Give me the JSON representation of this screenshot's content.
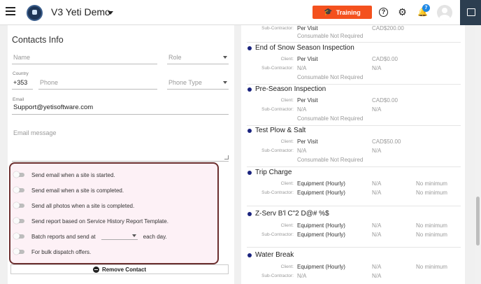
{
  "header": {
    "app_title": "V3 Yeti Demo",
    "training_label": "Training",
    "notification_count": "7"
  },
  "contacts": {
    "section_title": "Contacts Info",
    "name_placeholder": "Name",
    "role_placeholder": "Role",
    "country_label": "Country",
    "country_code": "+353",
    "phone_placeholder": "Phone",
    "phone_type_placeholder": "Phone Type",
    "email_label": "Email",
    "email_value": "Support@yetisoftware.com",
    "email_message_placeholder": "Email message",
    "options": [
      {
        "label": "Send email when a site is started."
      },
      {
        "label": "Send email when a site is completed."
      },
      {
        "label": "Send all photos when a site is completed."
      },
      {
        "label": "Send report based on Service History Report Template."
      },
      {
        "label": "Batch reports and send at",
        "suffix": "each day."
      },
      {
        "label": "For bulk dispatch offers."
      }
    ],
    "remove_label": "Remove Contact"
  },
  "services": {
    "client_label": "Client:",
    "subcontractor_label": "Sub-Contractor:",
    "consumable_text": "Consumable Not Required",
    "top": {
      "sub_value": "Per Visit",
      "sub_price": "CAD$200.00"
    },
    "items": [
      {
        "title": "End of Snow Season Inspection",
        "client_value": "Per Visit",
        "client_price": "CAD$0.00",
        "sub_value": "N/A",
        "sub_price": "N/A"
      },
      {
        "title": "Pre-Season Inspection",
        "client_value": "Per Visit",
        "client_price": "CAD$0.00",
        "sub_value": "N/A",
        "sub_price": "N/A"
      },
      {
        "title": "Test Plow & Salt",
        "client_value": "Per Visit",
        "client_price": "CAD$50.00",
        "sub_value": "N/A",
        "sub_price": "N/A"
      },
      {
        "title": "Trip Charge",
        "client_value": "Equipment (Hourly)",
        "client_price": "N/A",
        "client_min": "No minimum",
        "sub_value": "Equipment (Hourly)",
        "sub_price": "N/A",
        "sub_min": "No minimum"
      },
      {
        "title": "Z-Serv B'l C\"2 D@# %$",
        "client_value": "Equipment (Hourly)",
        "client_price": "N/A",
        "client_min": "No minimum",
        "sub_value": "Equipment (Hourly)",
        "sub_price": "N/A",
        "sub_min": "No minimum"
      },
      {
        "title": "Water Break",
        "client_value": "Equipment (Hourly)",
        "client_price": "N/A",
        "client_min": "No minimum",
        "sub_value": "N/A",
        "sub_price": "N/A"
      }
    ]
  },
  "colors": {
    "accent": "#f4511e",
    "highlight_border": "#6b2e2e",
    "dot": "#1a237e",
    "badge": "#1e88e5"
  }
}
